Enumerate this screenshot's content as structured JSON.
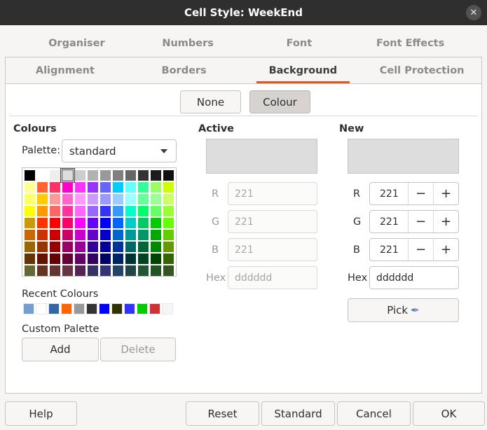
{
  "window": {
    "title": "Cell Style: WeekEnd",
    "close_icon": "close-icon"
  },
  "tabs_row1": [
    "Organiser",
    "Numbers",
    "Font",
    "Font Effects"
  ],
  "tabs_row2": [
    "Alignment",
    "Borders",
    "Background",
    "Cell Protection"
  ],
  "active_tab": "Background",
  "fill_buttons": {
    "none": "None",
    "colour": "Colour",
    "pressed": "Colour"
  },
  "colours": {
    "heading": "Colours",
    "palette_label": "Palette:",
    "palette_value": "standard",
    "swatches": [
      [
        "#000000",
        "#ffffff",
        "#eeeeee",
        "#dddddd",
        "#cccccc",
        "#b2b2b2",
        "#999999",
        "#808080",
        "#666666",
        "#333333",
        "#1c1c1c",
        "#111111"
      ],
      [
        "#ffff99",
        "#ff6633",
        "#ff3366",
        "#ff00cc",
        "#ff33ff",
        "#9933ff",
        "#6666ff",
        "#00ccff",
        "#66ffff",
        "#33ff99",
        "#99ff66",
        "#ccff00"
      ],
      [
        "#ffff66",
        "#ffcc00",
        "#ff9999",
        "#ff66cc",
        "#ff99ff",
        "#cc99ff",
        "#9999ff",
        "#99ccff",
        "#99ffff",
        "#66ff99",
        "#99ff99",
        "#ccff66"
      ],
      [
        "#ffff00",
        "#ff9900",
        "#ff6666",
        "#ff3399",
        "#ff66ff",
        "#9966ff",
        "#3333ff",
        "#3399ff",
        "#00ffcc",
        "#00ff66",
        "#66ff66",
        "#99ff33"
      ],
      [
        "#cc9900",
        "#ff3300",
        "#ff0000",
        "#ff0066",
        "#ff00ff",
        "#6600ff",
        "#0000ff",
        "#0066ff",
        "#00cccc",
        "#00cc66",
        "#00cc00",
        "#66ff00"
      ],
      [
        "#cc6600",
        "#cc3300",
        "#cc0000",
        "#cc0066",
        "#cc00cc",
        "#6600cc",
        "#0000cc",
        "#0066cc",
        "#009999",
        "#009966",
        "#00aa00",
        "#66cc00"
      ],
      [
        "#996600",
        "#993300",
        "#990000",
        "#990066",
        "#990099",
        "#330099",
        "#000099",
        "#003399",
        "#006666",
        "#006633",
        "#008800",
        "#669900"
      ],
      [
        "#663300",
        "#661100",
        "#660000",
        "#660033",
        "#660066",
        "#330066",
        "#000066",
        "#002266",
        "#003333",
        "#004422",
        "#004400",
        "#336600"
      ],
      [
        "#666633",
        "#663322",
        "#663333",
        "#663344",
        "#552255",
        "#333366",
        "#333377",
        "#224466",
        "#224444",
        "#225533",
        "#225522",
        "#335522"
      ]
    ],
    "selected_swatch": "#dddddd",
    "recent_label": "Recent Colours",
    "recent": [
      "#729fcf",
      "#ffffff",
      "#3465a4",
      "#ff6600",
      "#999999",
      "#333333",
      "#0000ff",
      "#333300",
      "#3333ff",
      "#00cc00",
      "#cc3333",
      "#f5f5f5"
    ],
    "custom_label": "Custom Palette",
    "add_label": "Add",
    "delete_label": "Delete"
  },
  "active": {
    "heading": "Active",
    "preview_color": "#dddddd",
    "r_label": "R",
    "r": "221",
    "g_label": "G",
    "g": "221",
    "b_label": "B",
    "b": "221",
    "hex_label": "Hex",
    "hex": "dddddd"
  },
  "new": {
    "heading": "New",
    "preview_color": "#dddddd",
    "r_label": "R",
    "r": "221",
    "g_label": "G",
    "g": "221",
    "b_label": "B",
    "b": "221",
    "minus": "−",
    "plus": "+",
    "hex_label": "Hex",
    "hex": "dddddd",
    "pick_label": "Pick",
    "pick_icon": "pipette-icon"
  },
  "footer": {
    "help": "Help",
    "reset": "Reset",
    "standard": "Standard",
    "cancel": "Cancel",
    "ok": "OK"
  }
}
